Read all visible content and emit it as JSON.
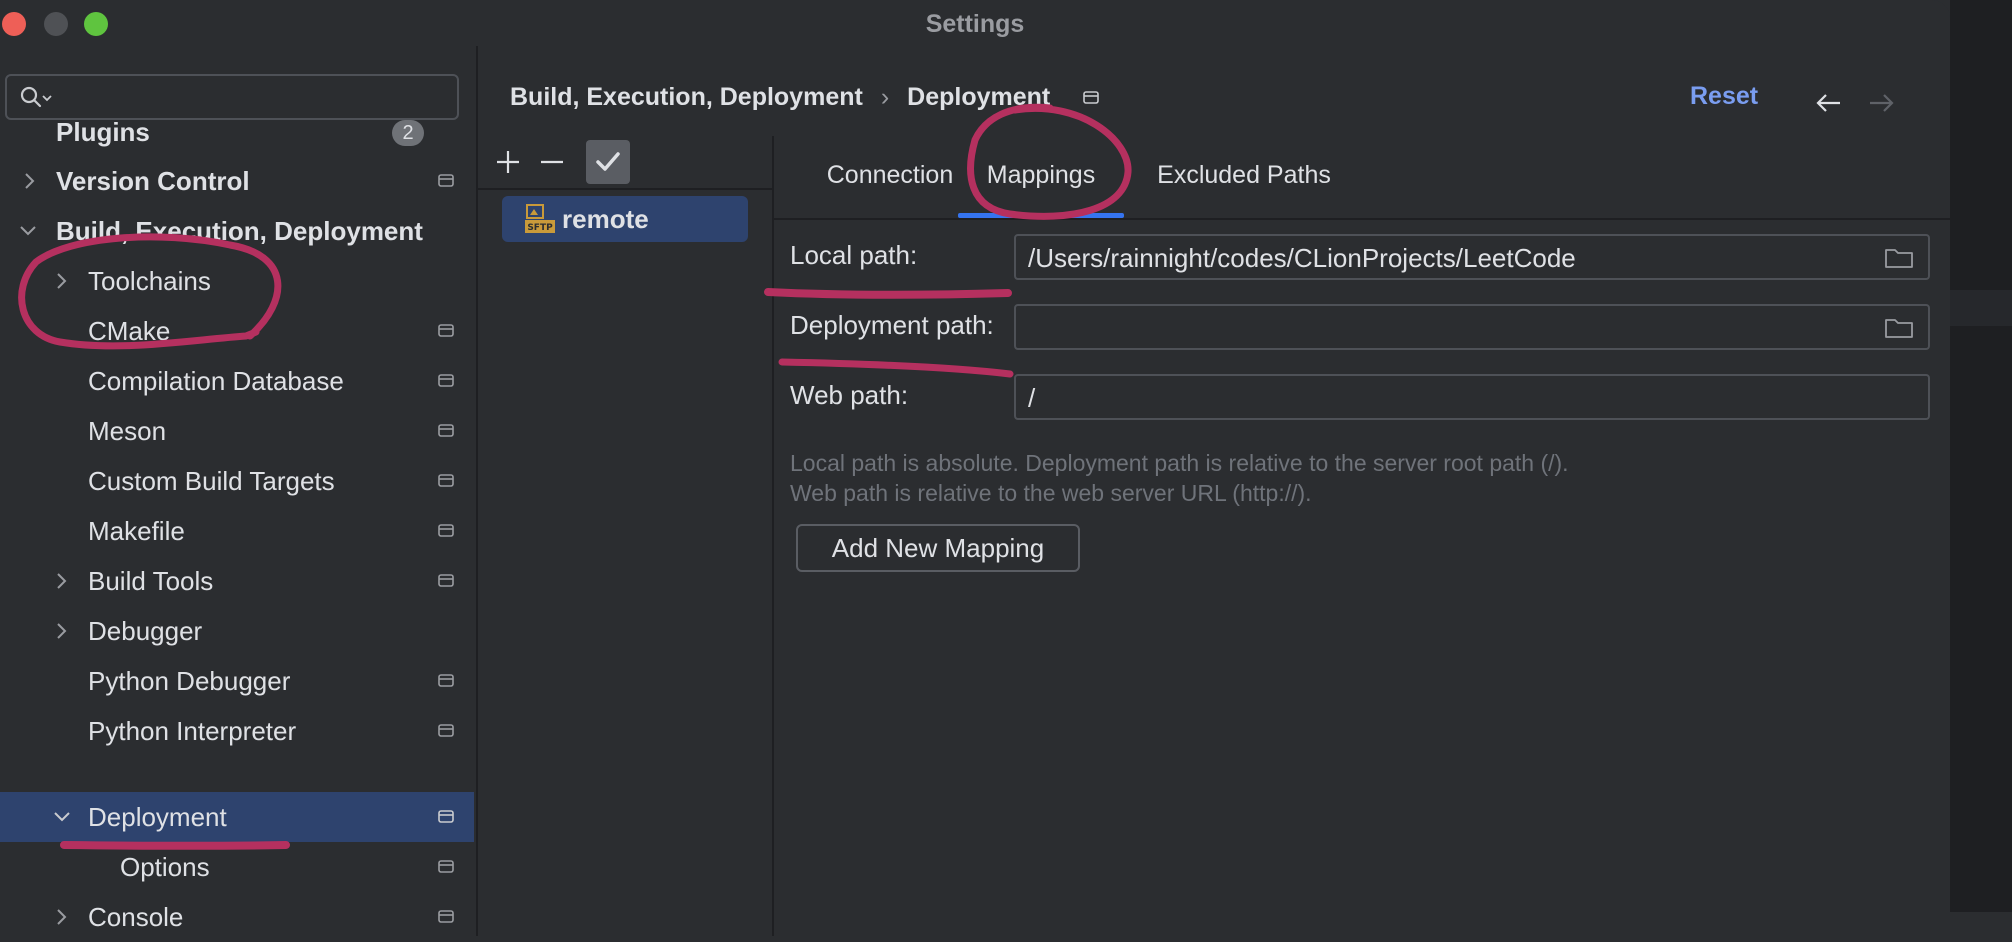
{
  "window": {
    "title": "Settings"
  },
  "search": {
    "value": "",
    "placeholder": ""
  },
  "sidebar": {
    "items": [
      {
        "label": "Plugins",
        "badge": "2"
      },
      {
        "label": "Version Control"
      },
      {
        "label": "Build, Execution, Deployment"
      },
      {
        "label": "Toolchains"
      },
      {
        "label": "CMake"
      },
      {
        "label": "Compilation Database"
      },
      {
        "label": "Meson"
      },
      {
        "label": "Custom Build Targets"
      },
      {
        "label": "Makefile"
      },
      {
        "label": "Build Tools"
      },
      {
        "label": "Debugger"
      },
      {
        "label": "Python Debugger"
      },
      {
        "label": "Python Interpreter"
      },
      {
        "label": "Deployment"
      },
      {
        "label": "Options"
      },
      {
        "label": "Console"
      }
    ]
  },
  "header": {
    "breadcrumb": [
      "Build, Execution, Deployment",
      "Deployment"
    ],
    "separator": "›",
    "reset_label": "Reset"
  },
  "servers": {
    "items": [
      {
        "label": "remote",
        "icon": "sftp-icon"
      }
    ]
  },
  "tabs": [
    {
      "label": "Connection"
    },
    {
      "label": "Mappings",
      "active": true
    },
    {
      "label": "Excluded Paths"
    }
  ],
  "form": {
    "local_path_label": "Local path:",
    "local_path_value": "/Users/rainnight/codes/CLionProjects/LeetCode",
    "deployment_path_label": "Deployment path:",
    "deployment_path_value": "",
    "web_path_label": "Web path:",
    "web_path_value": "/",
    "hint_line1": "Local path is absolute. Deployment path is relative to the server root path (/).",
    "hint_line2": "Web path is relative to the web server URL (http://).",
    "add_mapping_label": "Add New Mapping"
  },
  "colors": {
    "accent": "#3574f0",
    "selection": "#2e436e",
    "link": "#7a9df0",
    "annotation": "#b5305f"
  }
}
